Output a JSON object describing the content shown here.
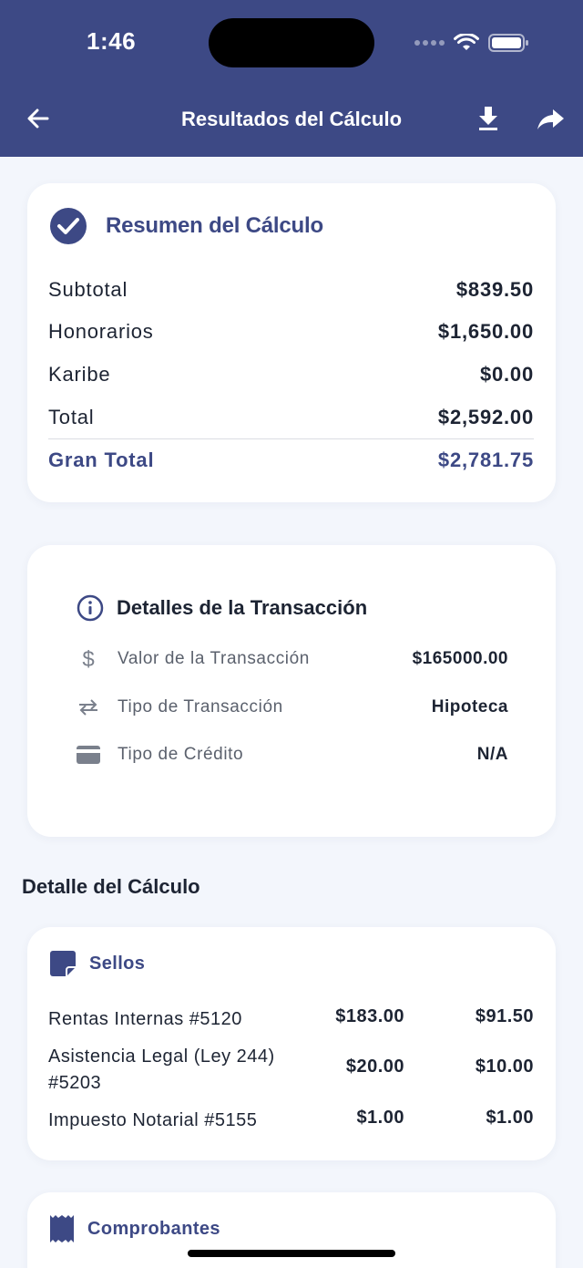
{
  "status": {
    "time": "1:46"
  },
  "nav": {
    "title": "Resultados del Cálculo"
  },
  "summary": {
    "title": "Resumen del Cálculo",
    "rows": [
      {
        "label": "Subtotal",
        "value": "$839.50"
      },
      {
        "label": "Honorarios",
        "value": "$1,650.00"
      },
      {
        "label": "Karibe",
        "value": "$0.00"
      },
      {
        "label": "Total",
        "value": "$2,592.00"
      }
    ],
    "grand": {
      "label": "Gran Total",
      "value": "$2,781.75"
    }
  },
  "details": {
    "title": "Detalles de la Transacción",
    "rows": [
      {
        "icon": "dollar-icon",
        "label": "Valor de la Transacción",
        "value": "$165000.00"
      },
      {
        "icon": "swap-arrows-icon",
        "label": "Tipo de Transacción",
        "value": "Hipoteca"
      },
      {
        "icon": "credit-card-icon",
        "label": "Tipo de Crédito",
        "value": "N/A"
      }
    ]
  },
  "calc_detail": {
    "heading": "Detalle del Cálculo",
    "sellos": {
      "title": "Sellos",
      "items": [
        {
          "name": "Rentas Internas #5120",
          "amount1": "$183.00",
          "amount2": "$91.50"
        },
        {
          "name": "Asistencia Legal (Ley 244) #5203",
          "amount1": "$20.00",
          "amount2": "$10.00"
        },
        {
          "name": "Impuesto Notarial #5155",
          "amount1": "$1.00",
          "amount2": "$1.00"
        }
      ]
    },
    "comprobantes": {
      "title": "Comprobantes"
    }
  },
  "colors": {
    "primary": "#3d4985",
    "background": "#f3f6fc",
    "card": "#ffffff",
    "text": "#1d2433",
    "muted": "#5b616d"
  }
}
